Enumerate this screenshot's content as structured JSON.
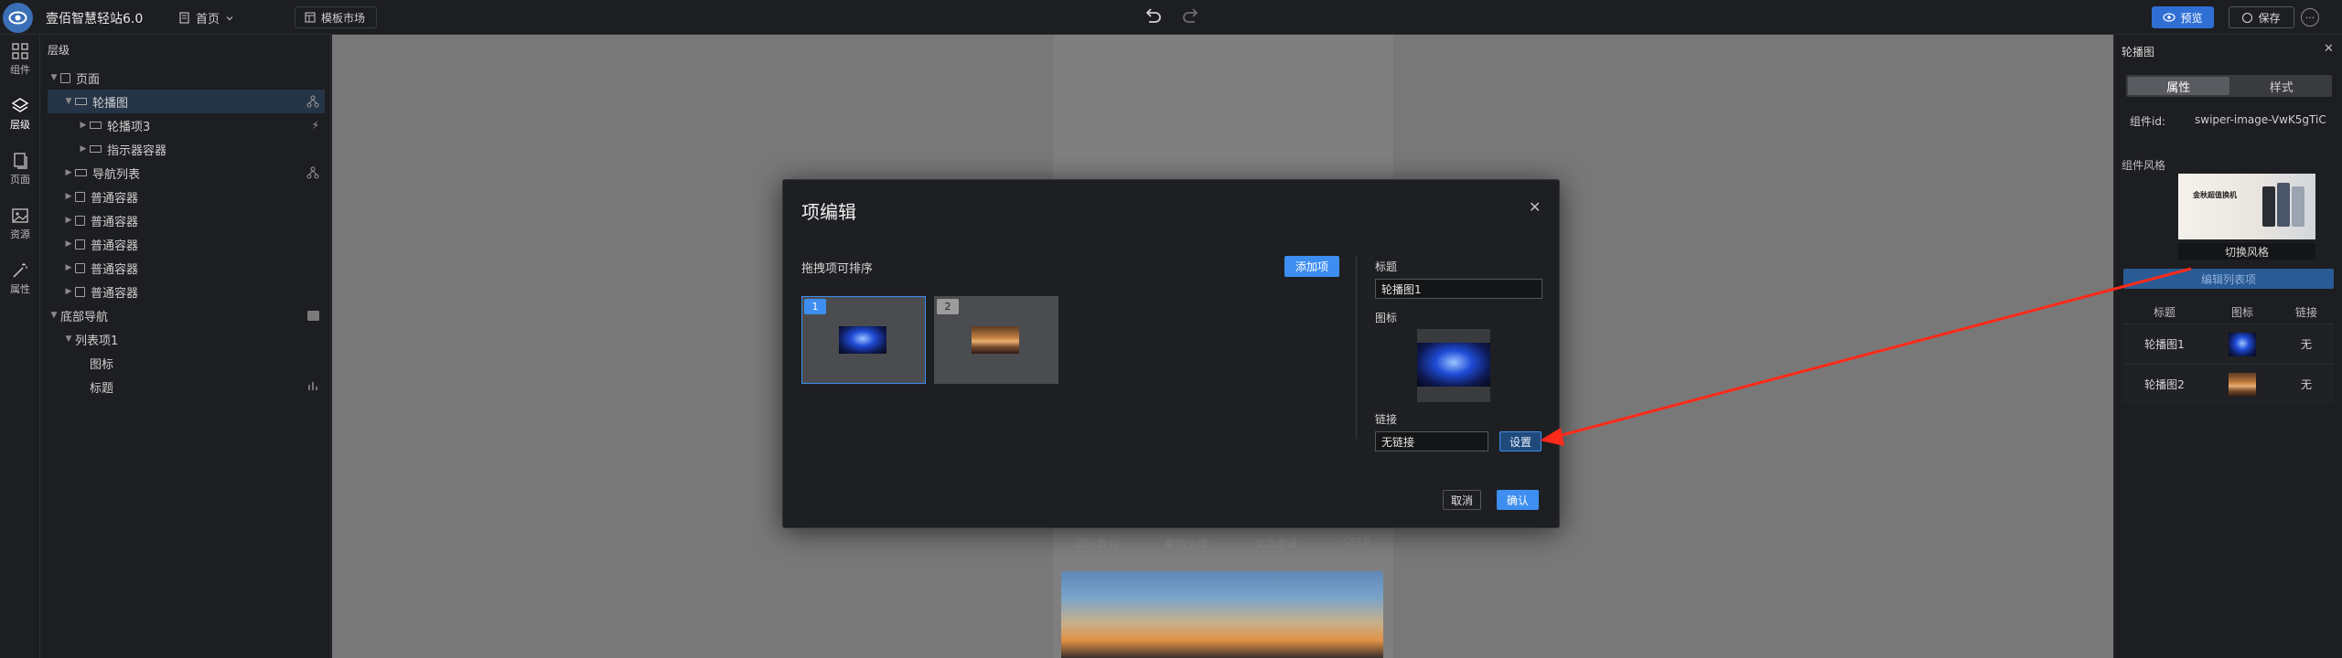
{
  "app": {
    "title": "壹佰智慧轻站6.0"
  },
  "topbar": {
    "page_select": "首页",
    "template_market": "模板市场",
    "preview": "预览",
    "save": "保存"
  },
  "rail": [
    {
      "label": "组件",
      "icon": "grid-icon"
    },
    {
      "label": "层级",
      "icon": "layers-icon"
    },
    {
      "label": "页面",
      "icon": "pages-icon"
    },
    {
      "label": "资源",
      "icon": "image-icon"
    },
    {
      "label": "属性",
      "icon": "magic-wand-icon"
    }
  ],
  "layers": {
    "title": "层级",
    "items": [
      {
        "label": "页面",
        "indent": 0
      },
      {
        "label": "轮播图",
        "indent": 1
      },
      {
        "label": "轮播项3",
        "indent": 2
      },
      {
        "label": "指示器容器",
        "indent": 2
      },
      {
        "label": "导航列表",
        "indent": 1
      },
      {
        "label": "普通容器",
        "indent": 1
      },
      {
        "label": "普通容器",
        "indent": 1
      },
      {
        "label": "普通容器",
        "indent": 1
      },
      {
        "label": "普通容器",
        "indent": 1
      },
      {
        "label": "普通容器",
        "indent": 1
      },
      {
        "label": "底部导航",
        "indent": 0
      },
      {
        "label": "列表项1",
        "indent": 1
      },
      {
        "label": "图标",
        "indent": 2
      },
      {
        "label": "标题",
        "indent": 2
      }
    ]
  },
  "canvas": {
    "nav": [
      "国际舞台",
      "奏响全球",
      "交流邀请",
      "SFTP"
    ]
  },
  "modal": {
    "title": "项编辑",
    "drag_tip": "拖拽项可排序",
    "add_item": "添加项",
    "items": [
      {
        "num": "1"
      },
      {
        "num": "2"
      }
    ],
    "title_label": "标题",
    "title_value": "轮播图1",
    "icon_label": "图标",
    "link_label": "链接",
    "link_value": "无链接",
    "set": "设置",
    "cancel": "取消",
    "ok": "确认"
  },
  "rpanel": {
    "title": "轮播图",
    "tabs": [
      "属性",
      "样式"
    ],
    "id_label": "组件id:",
    "id_value": "swiper-image-VwK5gTiC",
    "style_label": "组件风格",
    "style_thumb_text": "金秋超值换机",
    "switch_style": "切换风格",
    "edit_list": "编辑列表项",
    "table_headers": [
      "标题",
      "图标",
      "链接"
    ],
    "rows": [
      {
        "title": "轮播图1",
        "link": "无"
      },
      {
        "title": "轮播图2",
        "link": "无"
      }
    ]
  },
  "colors": {
    "accent": "#3d8ef0",
    "annotation_arrow": "#ff2a1a"
  }
}
